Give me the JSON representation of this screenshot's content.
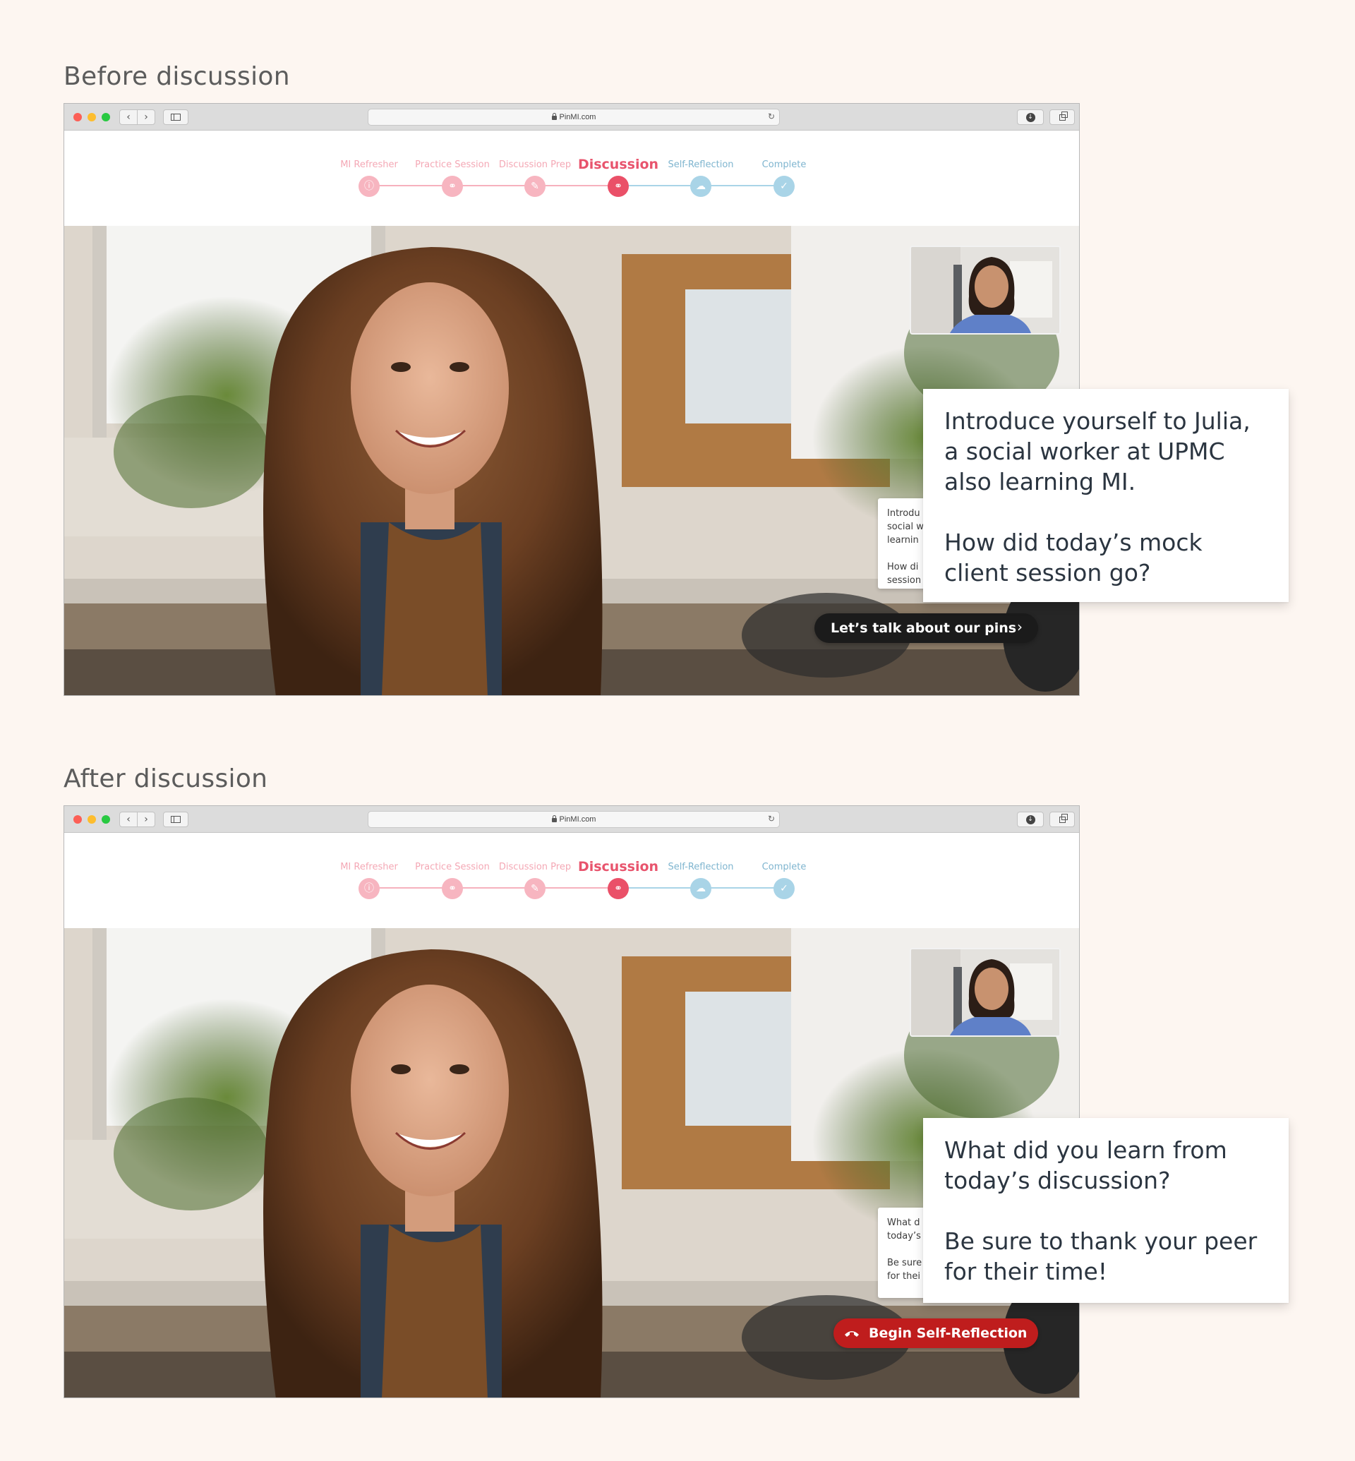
{
  "sections": [
    {
      "heading": "Before discussion",
      "browser": {
        "url": "PinMI.com"
      },
      "steps": [
        {
          "label": "MI Refresher",
          "state": "done",
          "icon": "info-icon"
        },
        {
          "label": "Practice Session",
          "state": "done",
          "icon": "pills-icon"
        },
        {
          "label": "Discussion Prep",
          "state": "done",
          "icon": "pencil-icon"
        },
        {
          "label": "Discussion",
          "state": "current",
          "icon": "pills-icon"
        },
        {
          "label": "Self-Reflection",
          "state": "todo",
          "icon": "chat-bubble-icon"
        },
        {
          "label": "Complete",
          "state": "todo",
          "icon": "checkmark-icon"
        }
      ],
      "prompt": {
        "paragraph_1": "Introduce yourself to Julia, a social worker at UPMC also learning MI.",
        "paragraph_2": "How did today’s mock client session go?"
      },
      "prompt_peek": {
        "line_1": "Introdu",
        "line_2": "social w",
        "line_3": "learnin",
        "line_4": "How di",
        "line_5": "session"
      },
      "cta": {
        "label": "Let’s talk about our pins",
        "icon": "chevron-right-icon"
      }
    },
    {
      "heading": "After discussion",
      "browser": {
        "url": "PinMI.com"
      },
      "steps": [
        {
          "label": "MI Refresher",
          "state": "done",
          "icon": "info-icon"
        },
        {
          "label": "Practice Session",
          "state": "done",
          "icon": "pills-icon"
        },
        {
          "label": "Discussion Prep",
          "state": "done",
          "icon": "pencil-icon"
        },
        {
          "label": "Discussion",
          "state": "current",
          "icon": "pills-icon"
        },
        {
          "label": "Self-Reflection",
          "state": "todo",
          "icon": "chat-bubble-icon"
        },
        {
          "label": "Complete",
          "state": "todo",
          "icon": "checkmark-icon"
        }
      ],
      "prompt": {
        "paragraph_1": "What did you learn from today’s discussion?",
        "paragraph_2": "Be sure to thank your peer for their time!"
      },
      "prompt_peek": {
        "line_1": "What d",
        "line_2": "today’s",
        "line_3": "Be sure",
        "line_4": "for thei"
      },
      "cta": {
        "label": "Begin Self-Reflection",
        "icon": "hang-up-phone-icon"
      }
    }
  ],
  "colors": {
    "page_background": "#fdf6f1",
    "step_done": "#f7b5c0",
    "step_current": "#ea5068",
    "step_todo": "#a9d4e7",
    "cta_dark": "#1b1b1b",
    "cta_end_call": "#bf1d1d"
  }
}
